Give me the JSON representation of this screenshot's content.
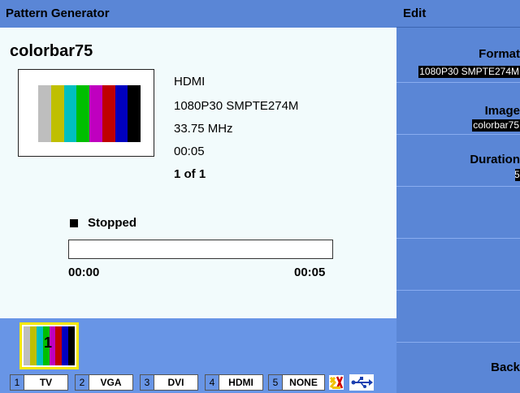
{
  "header": {
    "title": "Pattern Generator"
  },
  "pattern": {
    "name": "colorbar75",
    "interface": "HDMI",
    "format": "1080P30 SMPTE274M",
    "clock": "33.75 MHz",
    "duration": "00:05",
    "index": "1 of 1",
    "bar_colors": [
      "#bebebe",
      "#bfbf00",
      "#00bfbf",
      "#00bf00",
      "#bf00bf",
      "#bf0000",
      "#0000bf",
      "#000000"
    ]
  },
  "player": {
    "status": "Stopped",
    "progress": 0,
    "time_start": "00:00",
    "time_end": "00:05"
  },
  "thumbnails": [
    {
      "number": "1",
      "selected": true
    }
  ],
  "ports": [
    {
      "num": "1",
      "label": "TV"
    },
    {
      "num": "2",
      "label": "VGA"
    },
    {
      "num": "3",
      "label": "DVI"
    },
    {
      "num": "4",
      "label": "HDMI"
    },
    {
      "num": "5",
      "label": "NONE"
    }
  ],
  "status_icons": [
    "warning-icon",
    "usb-icon"
  ],
  "edit_panel": {
    "title": "Edit",
    "softkeys": [
      {
        "title": "Format",
        "value": "1080P30 SMPTE274M"
      },
      {
        "title": "Image",
        "value": "colorbar75"
      },
      {
        "title": "Duration",
        "value": "5"
      },
      {
        "title": "",
        "value": ""
      },
      {
        "title": "",
        "value": ""
      },
      {
        "title": "",
        "value": ""
      },
      {
        "title": "Back",
        "value": ""
      }
    ]
  },
  "colors": {
    "title_blue": "#5a86d6",
    "strip_blue": "#6895e6",
    "panel_bg": "#f2fbfc",
    "highlight": "#f5e800"
  }
}
